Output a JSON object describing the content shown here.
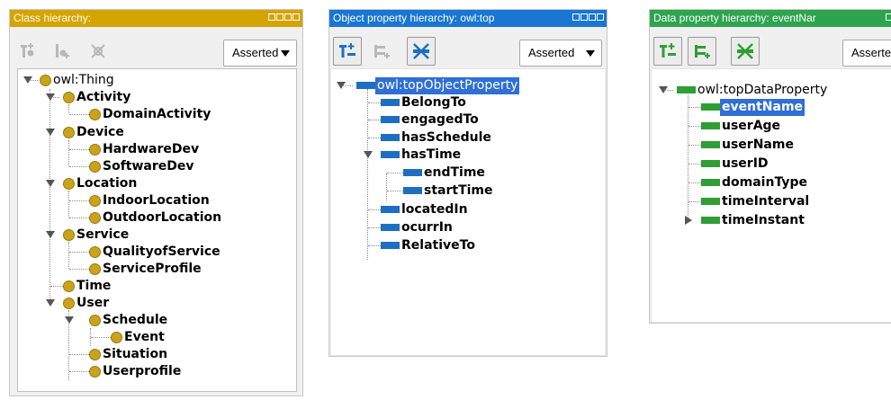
{
  "colors": {
    "class_title": "#d6a400",
    "object_title": "#1976d2",
    "data_title": "#2ea44f",
    "selection": "#2f6fd6"
  },
  "class_panel": {
    "title": "Class hierarchy:",
    "toolbar": [
      {
        "icon": "add-subclass-icon"
      },
      {
        "icon": "add-sibling-class-icon"
      },
      {
        "icon": "delete-class-icon"
      }
    ],
    "dropdown": "Asserted",
    "tree": [
      {
        "label": "owl:Thing"
      },
      {
        "label": "Activity"
      },
      {
        "label": "DomainActivity"
      },
      {
        "label": "Device"
      },
      {
        "label": "HardwareDev"
      },
      {
        "label": "SoftwareDev"
      },
      {
        "label": "Location"
      },
      {
        "label": "IndoorLocation"
      },
      {
        "label": "OutdoorLocation"
      },
      {
        "label": "Service"
      },
      {
        "label": "QualityofService"
      },
      {
        "label": "ServiceProfile"
      },
      {
        "label": "Time"
      },
      {
        "label": "User"
      },
      {
        "label": "Schedule"
      },
      {
        "label": "Event"
      },
      {
        "label": "Situation"
      },
      {
        "label": "Userprofile"
      }
    ]
  },
  "object_panel": {
    "title": "Object property hierarchy: owl:top",
    "toolbar": [
      {
        "icon": "add-sub-property-icon"
      },
      {
        "icon": "add-sibling-property-icon"
      },
      {
        "icon": "delete-property-icon"
      }
    ],
    "dropdown": "Asserted",
    "tree": [
      {
        "label": "owl:topObjectProperty",
        "selected": true
      },
      {
        "label": "BelongTo"
      },
      {
        "label": "engagedTo"
      },
      {
        "label": "hasSchedule"
      },
      {
        "label": "hasTime"
      },
      {
        "label": "endTime"
      },
      {
        "label": "startTime"
      },
      {
        "label": "locatedIn"
      },
      {
        "label": "ocurrIn"
      },
      {
        "label": "RelativeTo"
      }
    ]
  },
  "data_panel": {
    "title": "Data property hierarchy: eventNar",
    "toolbar": [
      {
        "icon": "add-sub-property-icon"
      },
      {
        "icon": "add-sibling-property-icon"
      },
      {
        "icon": "delete-property-icon"
      }
    ],
    "dropdown": "Asserte",
    "tree": [
      {
        "label": "owl:topDataProperty"
      },
      {
        "label": "eventName",
        "selected": true
      },
      {
        "label": "userAge"
      },
      {
        "label": "userName"
      },
      {
        "label": "userID"
      },
      {
        "label": "domainType"
      },
      {
        "label": "timeInterval"
      },
      {
        "label": "timeInstant"
      }
    ]
  }
}
